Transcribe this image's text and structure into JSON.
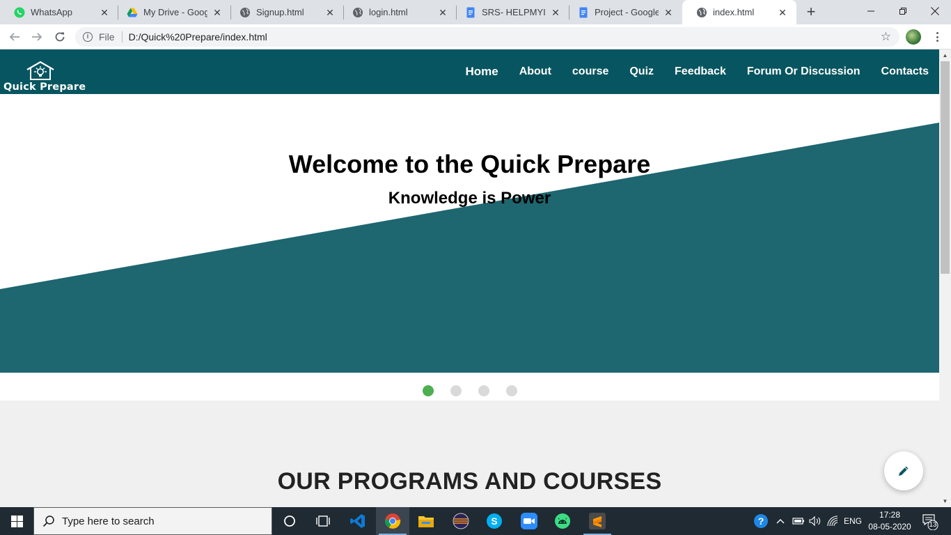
{
  "browser": {
    "tabs": [
      {
        "title": "WhatsApp",
        "icon": "whatsapp-icon",
        "active": false
      },
      {
        "title": "My Drive - Google",
        "icon": "google-drive-icon",
        "active": false
      },
      {
        "title": "Signup.html",
        "icon": "globe-icon",
        "active": false
      },
      {
        "title": "login.html",
        "icon": "globe-icon",
        "active": false
      },
      {
        "title": "SRS- HELPMYINTE",
        "icon": "google-docs-icon",
        "active": false
      },
      {
        "title": "Project - Google D",
        "icon": "google-docs-icon",
        "active": false
      },
      {
        "title": "index.html",
        "icon": "globe-icon",
        "active": true
      }
    ],
    "address": {
      "scheme_label": "File",
      "url": "D:/Quick%20Prepare/index.html"
    }
  },
  "site": {
    "logo_text": "Quick Prepare",
    "nav": [
      {
        "label": "Home"
      },
      {
        "label": "About"
      },
      {
        "label": "course"
      },
      {
        "label": "Quiz"
      },
      {
        "label": "Feedback"
      },
      {
        "label": "Forum Or Discussion"
      },
      {
        "label": "Contacts"
      }
    ],
    "hero": {
      "title": "Welcome to the Quick Prepare",
      "subtitle": "Knowledge is Power",
      "slide_count": 4,
      "active_slide": 1
    },
    "section_title": "OUR PROGRAMS AND COURSES",
    "colors": {
      "nav_bg": "#075560",
      "hero_band": "#1e6670",
      "dot_active": "#4caf50",
      "dot_inactive": "#d9d9d9"
    }
  },
  "taskbar": {
    "search_placeholder": "Type here to search",
    "apps": [
      "cortana-icon",
      "task-view-icon",
      "vscode-icon",
      "chrome-icon",
      "file-explorer-icon",
      "eclipse-icon",
      "skype-icon",
      "zoom-icon",
      "android-studio-icon",
      "sublime-text-icon"
    ],
    "language": "ENG",
    "time": "17:28",
    "date": "08-05-2020",
    "notification_count": "13"
  }
}
